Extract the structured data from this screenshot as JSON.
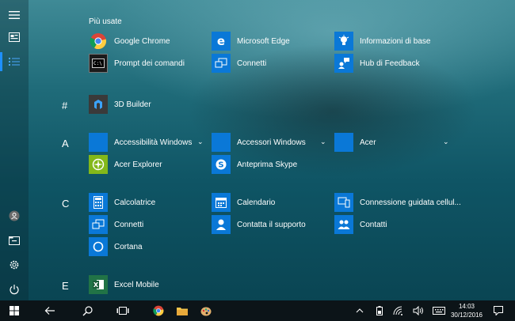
{
  "start_menu": {
    "most_used_title": "Più usate",
    "letters": {
      "hash": "#",
      "a": "A",
      "c": "C",
      "e": "E"
    },
    "apps": [
      {
        "label": "Google Chrome",
        "icon": "chrome-icon"
      },
      {
        "label": "Microsoft Edge",
        "icon": "edge-icon"
      },
      {
        "label": "Informazioni di base",
        "icon": "lightbulb-icon"
      },
      {
        "label": "Prompt dei comandi",
        "icon": "cmd-icon"
      },
      {
        "label": "Connetti",
        "icon": "connect-icon"
      },
      {
        "label": "Hub di Feedback",
        "icon": "feedback-icon"
      },
      {
        "label": "3D Builder",
        "icon": "3d-builder-icon"
      },
      {
        "label": "Accessibilità Windows",
        "icon": "folder-icon"
      },
      {
        "label": "Accessori Windows",
        "icon": "folder-icon"
      },
      {
        "label": "Acer",
        "icon": "folder-icon"
      },
      {
        "label": "Acer Explorer",
        "icon": "acer-explorer-icon"
      },
      {
        "label": "Anteprima Skype",
        "icon": "skype-icon"
      },
      {
        "label": "Calcolatrice",
        "icon": "calculator-icon"
      },
      {
        "label": "Calendario",
        "icon": "calendar-icon"
      },
      {
        "label": "Connessione guidata cellul...",
        "icon": "cellular-icon"
      },
      {
        "label": "Connetti",
        "icon": "connect-icon"
      },
      {
        "label": "Contatta il supporto",
        "icon": "support-icon"
      },
      {
        "label": "Contatti",
        "icon": "people-icon"
      },
      {
        "label": "Cortana",
        "icon": "cortana-icon"
      },
      {
        "label": "Excel Mobile",
        "icon": "excel-icon"
      }
    ]
  },
  "taskbar": {
    "time": "14:03",
    "date": "30/12/2016"
  },
  "colors": {
    "tile_blue": "#0a78d7",
    "taskbar_bg": "#0c1418",
    "accent": "#1e90ff"
  }
}
